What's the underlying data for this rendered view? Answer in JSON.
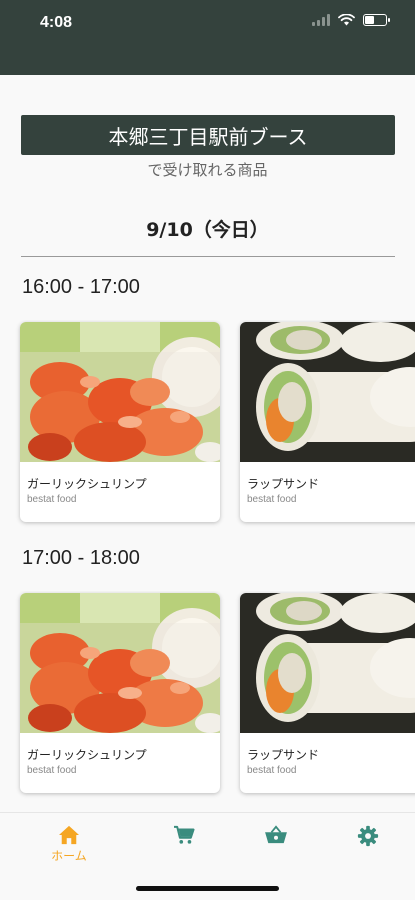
{
  "status": {
    "time": "4:08"
  },
  "booth": {
    "title": "本郷三丁目駅前ブース",
    "subtitle": "で受け取れる商品"
  },
  "date": {
    "title": "9/10（今日）"
  },
  "slots": [
    {
      "time": "16:00 - 17:00",
      "items": [
        {
          "name": "ガーリックシュリンプ",
          "brand": "bestat food",
          "image": "shrimp"
        },
        {
          "name": "ラップサンド",
          "brand": "bestat food",
          "image": "wrap"
        }
      ]
    },
    {
      "time": "17:00 - 18:00",
      "items": [
        {
          "name": "ガーリックシュリンプ",
          "brand": "bestat food",
          "image": "shrimp"
        },
        {
          "name": "ラップサンド",
          "brand": "bestat food",
          "image": "wrap"
        }
      ]
    }
  ],
  "tabbar": {
    "active": "home",
    "tabs": [
      {
        "id": "home",
        "label": "ホーム",
        "icon": "home-icon"
      },
      {
        "id": "cart",
        "label": "",
        "icon": "cart-icon"
      },
      {
        "id": "basket",
        "label": "",
        "icon": "basket-icon"
      },
      {
        "id": "settings",
        "label": "",
        "icon": "gear-icon"
      }
    ]
  },
  "colors": {
    "header": "#34423d",
    "accent": "#f5a623",
    "icon": "#3a8c7e"
  }
}
